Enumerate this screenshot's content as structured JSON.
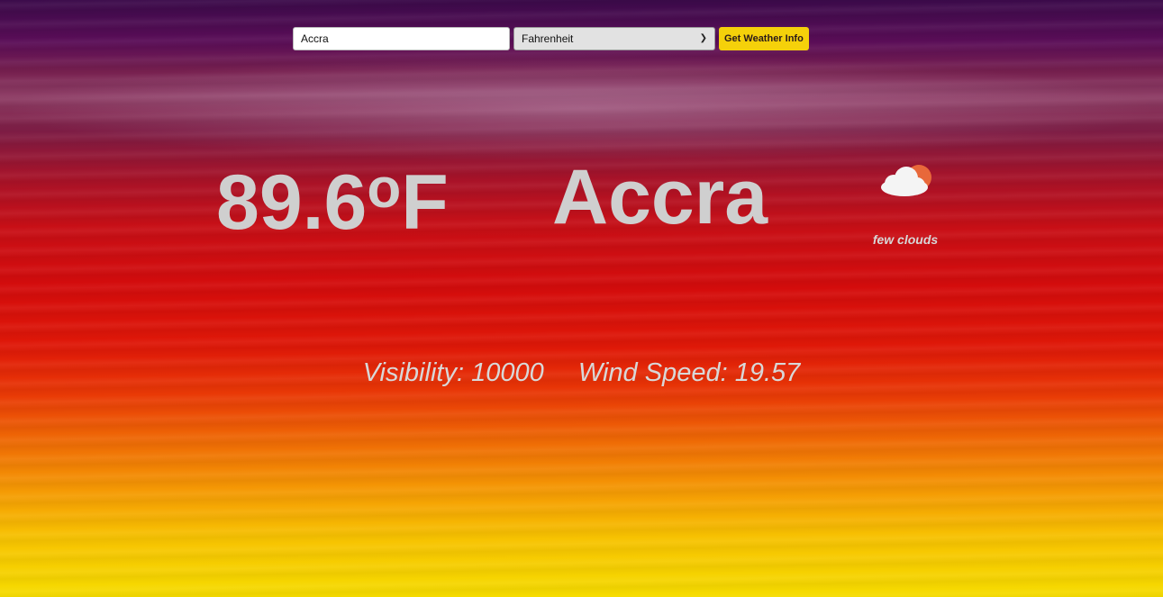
{
  "search": {
    "city_value": "Accra",
    "unit_selected": "Fahrenheit",
    "button_label": "Get Weather Info"
  },
  "weather": {
    "temperature": "89.6",
    "degree_symbol": "o",
    "unit_letter": "F",
    "city": "Accra",
    "description": "few clouds",
    "icon": "few-clouds-icon",
    "visibility_label": "Visibility:",
    "visibility_value": "10000",
    "wind_label": "Wind Speed:",
    "wind_value": "19.57"
  },
  "colors": {
    "button": "#f5d10a",
    "text": "#cfcfcf",
    "sun": "#e8683a"
  }
}
